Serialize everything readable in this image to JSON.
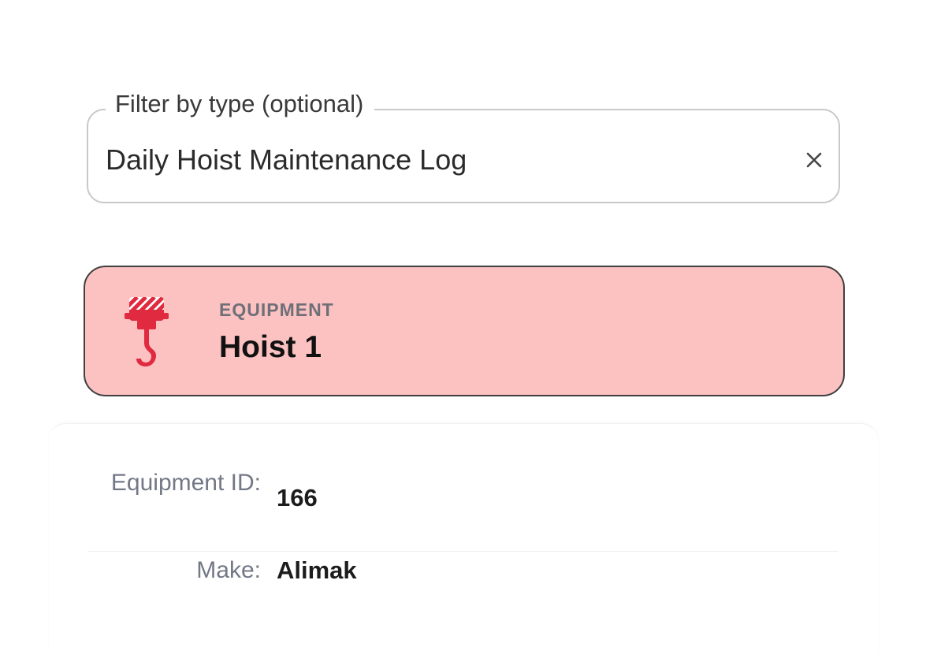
{
  "filter": {
    "label": "Filter by type (optional)",
    "value": "Daily Hoist Maintenance Log",
    "clear_icon": "close-icon"
  },
  "equipment_card": {
    "icon": "crane-hook-icon",
    "eyebrow": "EQUIPMENT",
    "title": "Hoist 1",
    "background_color": "#fcc1c1",
    "icon_color": "#e02a3f"
  },
  "details": {
    "rows": [
      {
        "label": "Equipment ID:",
        "value": "166"
      },
      {
        "label": "Make:",
        "value": "Alimak"
      }
    ]
  }
}
